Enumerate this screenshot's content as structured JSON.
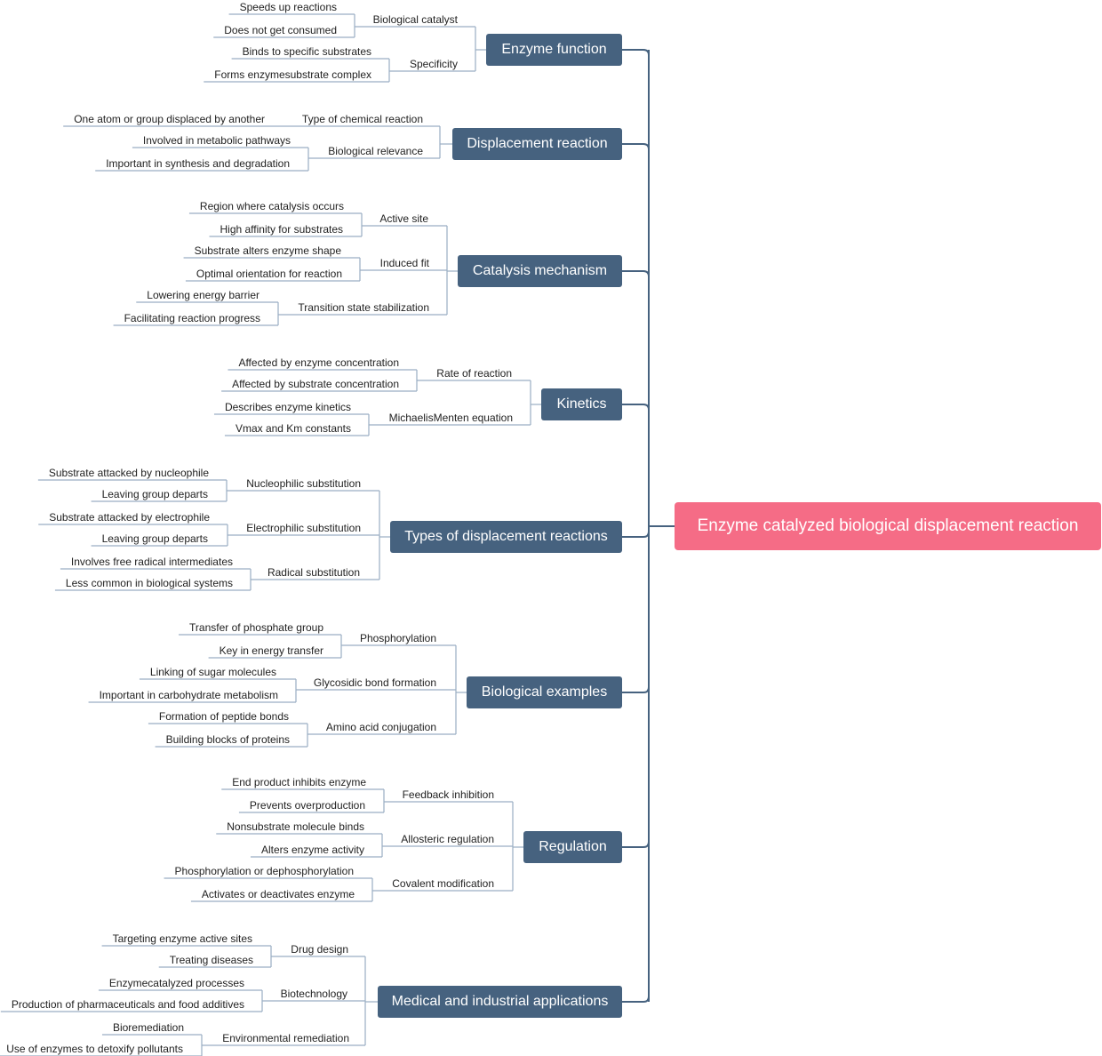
{
  "root": {
    "label": "Enzyme catalyzed biological displacement reaction",
    "color": "#f56c86"
  },
  "branch_color": "#46627f",
  "line_color": "#46627f",
  "leaf_line_color": "#9aaec3",
  "branches": [
    {
      "label": "Enzyme function",
      "children": [
        {
          "label": "Biological catalyst",
          "children": [
            "Speeds up reactions",
            "Does not get consumed"
          ]
        },
        {
          "label": "Specificity",
          "children": [
            "Binds to specific substrates",
            "Forms enzymesubstrate complex"
          ]
        }
      ]
    },
    {
      "label": "Displacement reaction",
      "children": [
        {
          "label": "Type of chemical reaction",
          "children": [
            "One atom or group displaced by another"
          ]
        },
        {
          "label": "Biological relevance",
          "children": [
            "Involved in metabolic pathways",
            "Important in synthesis and degradation"
          ]
        }
      ]
    },
    {
      "label": "Catalysis mechanism",
      "children": [
        {
          "label": "Active site",
          "children": [
            "Region where catalysis occurs",
            "High affinity for substrates"
          ]
        },
        {
          "label": "Induced fit",
          "children": [
            "Substrate alters enzyme shape",
            "Optimal orientation for reaction"
          ]
        },
        {
          "label": "Transition state stabilization",
          "children": [
            "Lowering energy barrier",
            "Facilitating reaction progress"
          ]
        }
      ]
    },
    {
      "label": "Kinetics",
      "children": [
        {
          "label": "Rate of reaction",
          "children": [
            "Affected by enzyme concentration",
            "Affected by substrate concentration"
          ]
        },
        {
          "label": "MichaelisMenten equation",
          "children": [
            "Describes enzyme kinetics",
            "Vmax and Km constants"
          ]
        }
      ]
    },
    {
      "label": "Types of displacement reactions",
      "children": [
        {
          "label": "Nucleophilic substitution",
          "children": [
            "Substrate attacked by nucleophile",
            "Leaving group departs"
          ]
        },
        {
          "label": "Electrophilic substitution",
          "children": [
            "Substrate attacked by electrophile",
            "Leaving group departs"
          ]
        },
        {
          "label": "Radical substitution",
          "children": [
            "Involves free radical intermediates",
            "Less common in biological systems"
          ]
        }
      ]
    },
    {
      "label": "Biological examples",
      "children": [
        {
          "label": "Phosphorylation",
          "children": [
            "Transfer of phosphate group",
            "Key in energy transfer"
          ]
        },
        {
          "label": "Glycosidic bond formation",
          "children": [
            "Linking of sugar molecules",
            "Important in carbohydrate metabolism"
          ]
        },
        {
          "label": "Amino acid conjugation",
          "children": [
            "Formation of peptide bonds",
            "Building blocks of proteins"
          ]
        }
      ]
    },
    {
      "label": "Regulation",
      "children": [
        {
          "label": "Feedback inhibition",
          "children": [
            "End product inhibits enzyme",
            "Prevents overproduction"
          ]
        },
        {
          "label": "Allosteric regulation",
          "children": [
            "Nonsubstrate molecule binds",
            "Alters enzyme activity"
          ]
        },
        {
          "label": "Covalent modification",
          "children": [
            "Phosphorylation or dephosphorylation",
            "Activates or deactivates enzyme"
          ]
        }
      ]
    },
    {
      "label": "Medical and industrial applications",
      "children": [
        {
          "label": "Drug design",
          "children": [
            "Targeting enzyme active sites",
            "Treating diseases"
          ]
        },
        {
          "label": "Biotechnology",
          "children": [
            "Enzymecatalyzed processes",
            "Production of pharmaceuticals and food additives"
          ]
        },
        {
          "label": "Environmental remediation",
          "children": [
            "Bioremediation",
            "Use of enzymes to detoxify pollutants"
          ]
        }
      ]
    }
  ]
}
